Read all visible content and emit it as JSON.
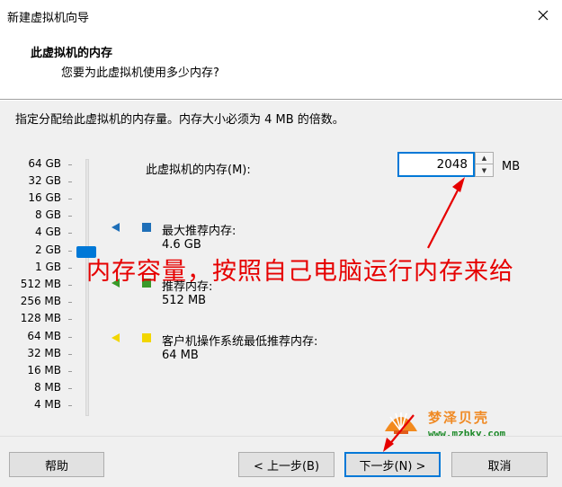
{
  "window": {
    "title": "新建虚拟机向导",
    "close_icon": "close-icon"
  },
  "header": {
    "title": "此虚拟机的内存",
    "subtitle": "您要为此虚拟机使用多少内存?"
  },
  "instruction": "指定分配给此虚拟机的内存量。内存大小必须为 4 MB 的倍数。",
  "scale": {
    "ticks": [
      "64 GB",
      "32 GB",
      "16 GB",
      "8 GB",
      "4 GB",
      "2 GB",
      "1 GB",
      "512 MB",
      "256 MB",
      "128 MB",
      "64 MB",
      "32 MB",
      "16 MB",
      "8 MB",
      "4 MB"
    ],
    "selected": "2 GB"
  },
  "memory": {
    "label": "此虚拟机的内存(M):",
    "value": "2048",
    "unit": "MB"
  },
  "legend": {
    "max": {
      "label": "最大推荐内存:",
      "value": "4.6 GB",
      "color": "#1e6fb8"
    },
    "recommended": {
      "label": "推荐内存:",
      "value": "512 MB",
      "color": "#3a9a2a"
    },
    "guest_min": {
      "label": "客户机操作系统最低推荐内存:",
      "value": "64 MB",
      "color": "#f2d600"
    }
  },
  "annotation": {
    "text": "内存容量，按照自己电脑运行内存来给",
    "color": "#e60000"
  },
  "watermark": {
    "brand": "梦泽贝壳",
    "url": "www.mzbky.com"
  },
  "buttons": {
    "help": "帮助",
    "back": "< 上一步(B)",
    "next": "下一步(N) >",
    "cancel": "取消"
  },
  "colors": {
    "accent": "#0078d7",
    "dialog_bg": "#f0f0f0"
  }
}
